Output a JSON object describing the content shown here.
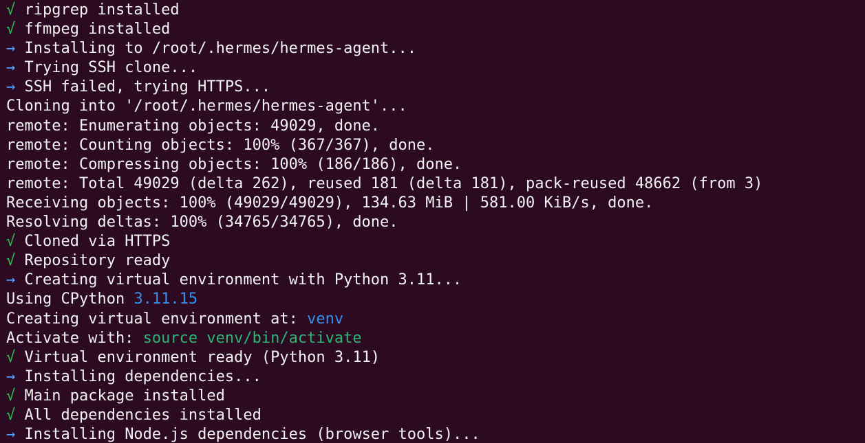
{
  "colors": {
    "background": "#2c0a22",
    "text": "#f2f2f2",
    "check": "#2fbf4f",
    "arrow": "#4aa3ff",
    "highlight_blue": "#3b8eea",
    "highlight_green": "#2bb673"
  },
  "lines": [
    {
      "prefix": "√",
      "prefix_type": "check",
      "parts": [
        {
          "text": " ripgrep installed",
          "style": ""
        }
      ]
    },
    {
      "prefix": "√",
      "prefix_type": "check",
      "parts": [
        {
          "text": " ffmpeg installed",
          "style": ""
        }
      ]
    },
    {
      "prefix": "→",
      "prefix_type": "arrow",
      "parts": [
        {
          "text": " Installing to /root/.hermes/hermes-agent...",
          "style": ""
        }
      ]
    },
    {
      "prefix": "→",
      "prefix_type": "arrow",
      "parts": [
        {
          "text": " Trying SSH clone...",
          "style": ""
        }
      ]
    },
    {
      "prefix": "→",
      "prefix_type": "arrow",
      "parts": [
        {
          "text": " SSH failed, trying HTTPS...",
          "style": ""
        }
      ]
    },
    {
      "prefix": "",
      "prefix_type": "",
      "parts": [
        {
          "text": "Cloning into '/root/.hermes/hermes-agent'...",
          "style": ""
        }
      ]
    },
    {
      "prefix": "",
      "prefix_type": "",
      "parts": [
        {
          "text": "remote: Enumerating objects: 49029, done.",
          "style": ""
        }
      ]
    },
    {
      "prefix": "",
      "prefix_type": "",
      "parts": [
        {
          "text": "remote: Counting objects: 100% (367/367), done.",
          "style": ""
        }
      ]
    },
    {
      "prefix": "",
      "prefix_type": "",
      "parts": [
        {
          "text": "remote: Compressing objects: 100% (186/186), done.",
          "style": ""
        }
      ]
    },
    {
      "prefix": "",
      "prefix_type": "",
      "parts": [
        {
          "text": "remote: Total 49029 (delta 262), reused 181 (delta 181), pack-reused 48662 (from 3)",
          "style": ""
        }
      ]
    },
    {
      "prefix": "",
      "prefix_type": "",
      "parts": [
        {
          "text": "Receiving objects: 100% (49029/49029), 134.63 MiB | 581.00 KiB/s, done.",
          "style": ""
        }
      ]
    },
    {
      "prefix": "",
      "prefix_type": "",
      "parts": [
        {
          "text": "Resolving deltas: 100% (34765/34765), done.",
          "style": ""
        }
      ]
    },
    {
      "prefix": "√",
      "prefix_type": "check",
      "parts": [
        {
          "text": " Cloned via HTTPS",
          "style": ""
        }
      ]
    },
    {
      "prefix": "√",
      "prefix_type": "check",
      "parts": [
        {
          "text": " Repository ready",
          "style": ""
        }
      ]
    },
    {
      "prefix": "→",
      "prefix_type": "arrow",
      "parts": [
        {
          "text": " Creating virtual environment with Python 3.11...",
          "style": ""
        }
      ]
    },
    {
      "prefix": "",
      "prefix_type": "",
      "parts": [
        {
          "text": "Using CPython ",
          "style": ""
        },
        {
          "text": "3.11.15",
          "style": "blue"
        }
      ]
    },
    {
      "prefix": "",
      "prefix_type": "",
      "parts": [
        {
          "text": "Creating virtual environment at: ",
          "style": ""
        },
        {
          "text": "venv",
          "style": "blue"
        }
      ]
    },
    {
      "prefix": "",
      "prefix_type": "",
      "parts": [
        {
          "text": "Activate with: ",
          "style": ""
        },
        {
          "text": "source venv/bin/activate",
          "style": "green"
        }
      ]
    },
    {
      "prefix": "√",
      "prefix_type": "check",
      "parts": [
        {
          "text": " Virtual environment ready (Python 3.11)",
          "style": ""
        }
      ]
    },
    {
      "prefix": "→",
      "prefix_type": "arrow",
      "parts": [
        {
          "text": " Installing dependencies...",
          "style": ""
        }
      ]
    },
    {
      "prefix": "√",
      "prefix_type": "check",
      "parts": [
        {
          "text": " Main package installed",
          "style": ""
        }
      ]
    },
    {
      "prefix": "√",
      "prefix_type": "check",
      "parts": [
        {
          "text": " All dependencies installed",
          "style": ""
        }
      ]
    },
    {
      "prefix": "→",
      "prefix_type": "arrow",
      "parts": [
        {
          "text": " Installing Node.js dependencies (browser tools)...",
          "style": ""
        }
      ]
    }
  ]
}
